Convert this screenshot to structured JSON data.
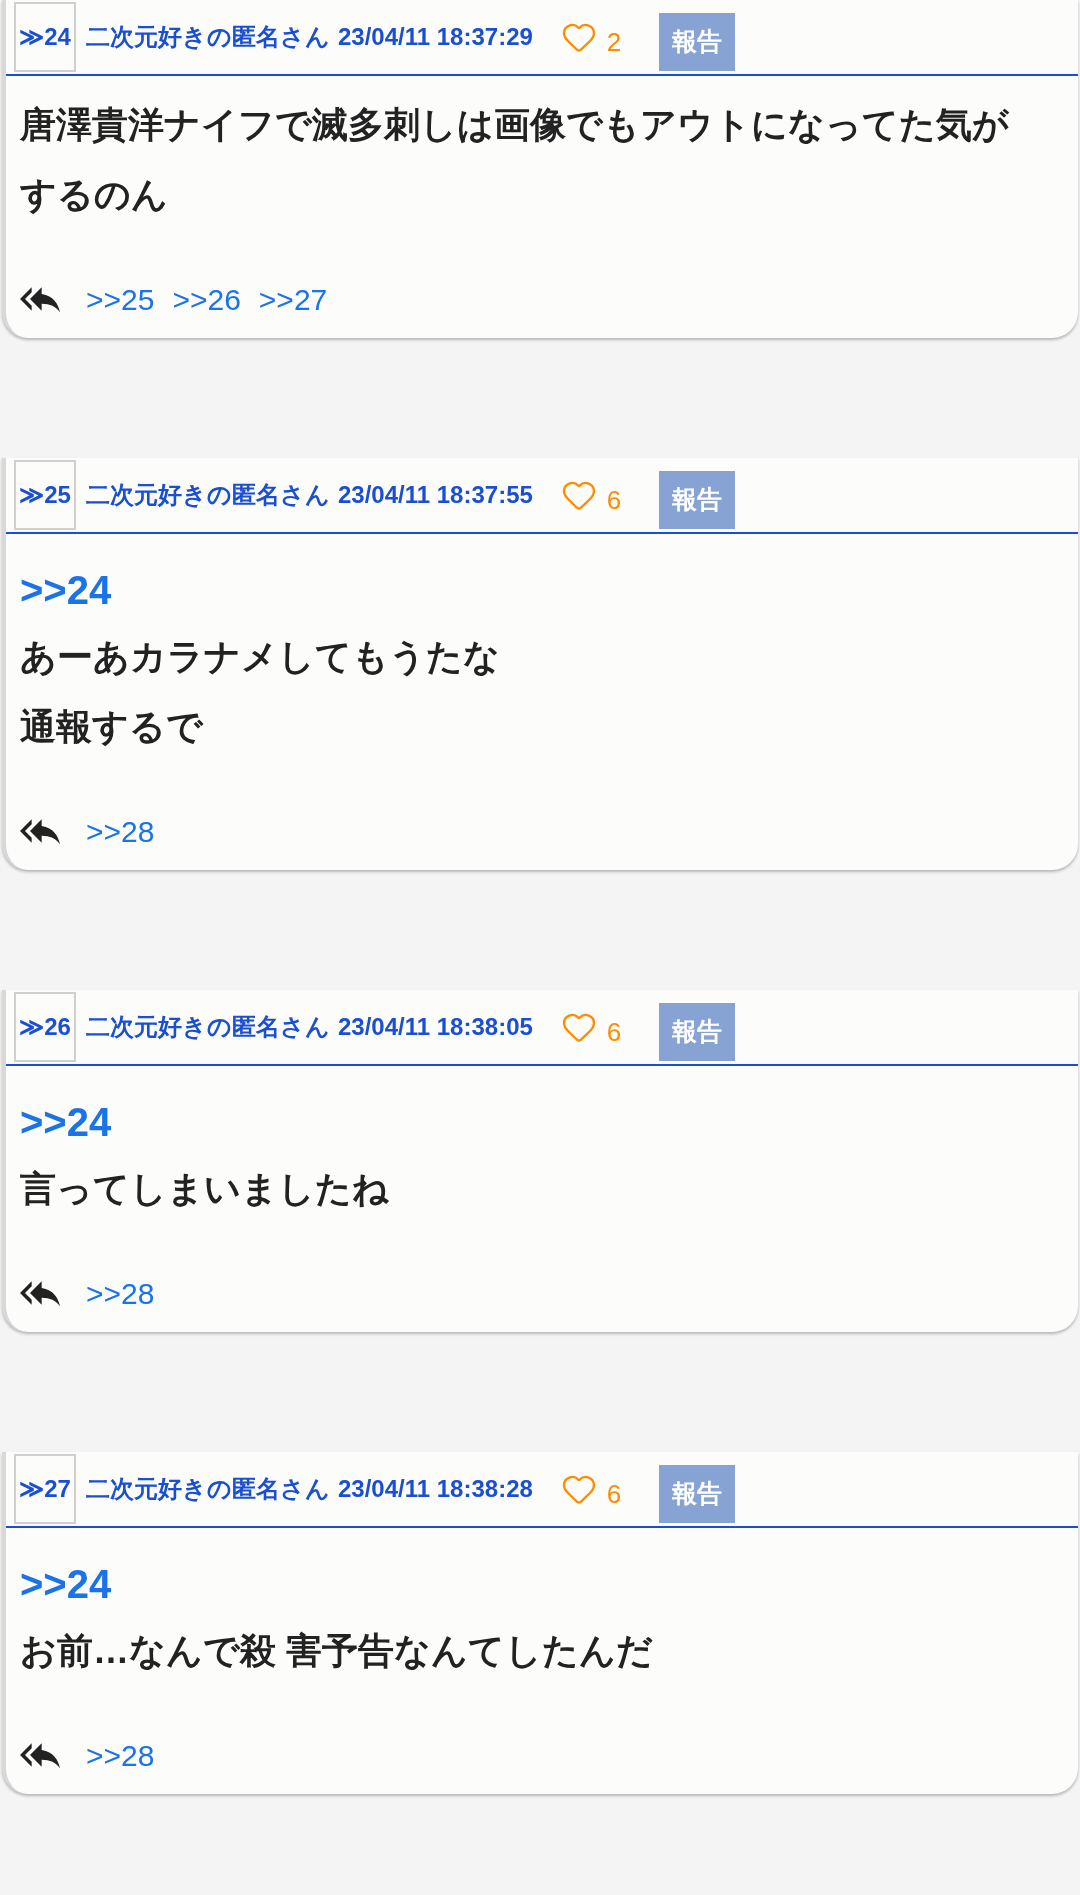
{
  "posts": [
    {
      "number": "≫24",
      "author": "二次元好きの匿名さん",
      "datetime": "23/04/11 18:37:29",
      "likes": "2",
      "report": "報告",
      "lines": [
        "唐澤貴洋ナイフで滅多刺しは画像でもアウトになってた気がするのん"
      ],
      "replies": [
        ">>25",
        ">>26",
        ">>27"
      ]
    },
    {
      "number": "≫25",
      "author": "二次元好きの匿名さん",
      "datetime": "23/04/11 18:37:55",
      "likes": "6",
      "report": "報告",
      "quote": ">>24",
      "lines": [
        "あーあカラナメしてもうたな",
        "通報するで"
      ],
      "replies": [
        ">>28"
      ]
    },
    {
      "number": "≫26",
      "author": "二次元好きの匿名さん",
      "datetime": "23/04/11 18:38:05",
      "likes": "6",
      "report": "報告",
      "quote": ">>24",
      "lines": [
        "言ってしまいましたね"
      ],
      "replies": [
        ">>28"
      ]
    },
    {
      "number": "≫27",
      "author": "二次元好きの匿名さん",
      "datetime": "23/04/11 18:38:28",
      "likes": "6",
      "report": "報告",
      "quote": ">>24",
      "lines": [
        "お前…なんで殺 害予告なんてしたんだ"
      ],
      "replies": [
        ">>28"
      ]
    }
  ]
}
